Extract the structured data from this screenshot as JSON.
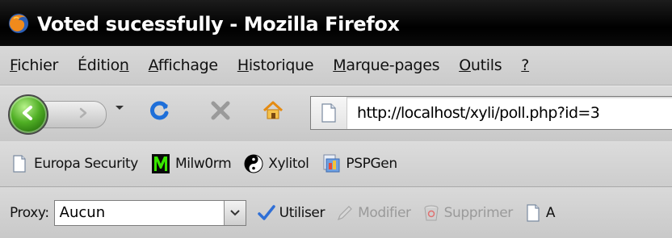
{
  "window": {
    "title": "Voted sucessfully - Mozilla Firefox"
  },
  "menu": {
    "items": [
      {
        "pre": "",
        "mn": "F",
        "post": "ichier"
      },
      {
        "pre": "Éditio",
        "mn": "n",
        "post": ""
      },
      {
        "pre": "",
        "mn": "A",
        "post": "ffichage"
      },
      {
        "pre": "",
        "mn": "H",
        "post": "istorique"
      },
      {
        "pre": "",
        "mn": "M",
        "post": "arque-pages"
      },
      {
        "pre": "",
        "mn": "O",
        "post": "utils"
      },
      {
        "pre": "",
        "mn": "?",
        "post": ""
      }
    ]
  },
  "nav": {
    "url": "http://localhost/xyli/poll.php?id=3"
  },
  "bookmarks": {
    "items": [
      {
        "label": "Europa Security",
        "icon": "page-icon"
      },
      {
        "label": "Milw0rm",
        "icon": "milw0rm-icon"
      },
      {
        "label": "Xylitol",
        "icon": "yin-yang-icon"
      },
      {
        "label": "PSPGen",
        "icon": "pspgen-icon"
      }
    ]
  },
  "proxy": {
    "label": "Proxy:",
    "selected": "Aucun",
    "use_label": "Utiliser",
    "edit_label": "Modifier",
    "delete_label": "Supprimer",
    "add_label": "A"
  },
  "colors": {
    "titlebar": "#000000",
    "toolbar": "#d4d4d4",
    "back_green": "#4fae24",
    "reload_blue": "#1e6fd9",
    "check_blue": "#2f6fd6"
  }
}
